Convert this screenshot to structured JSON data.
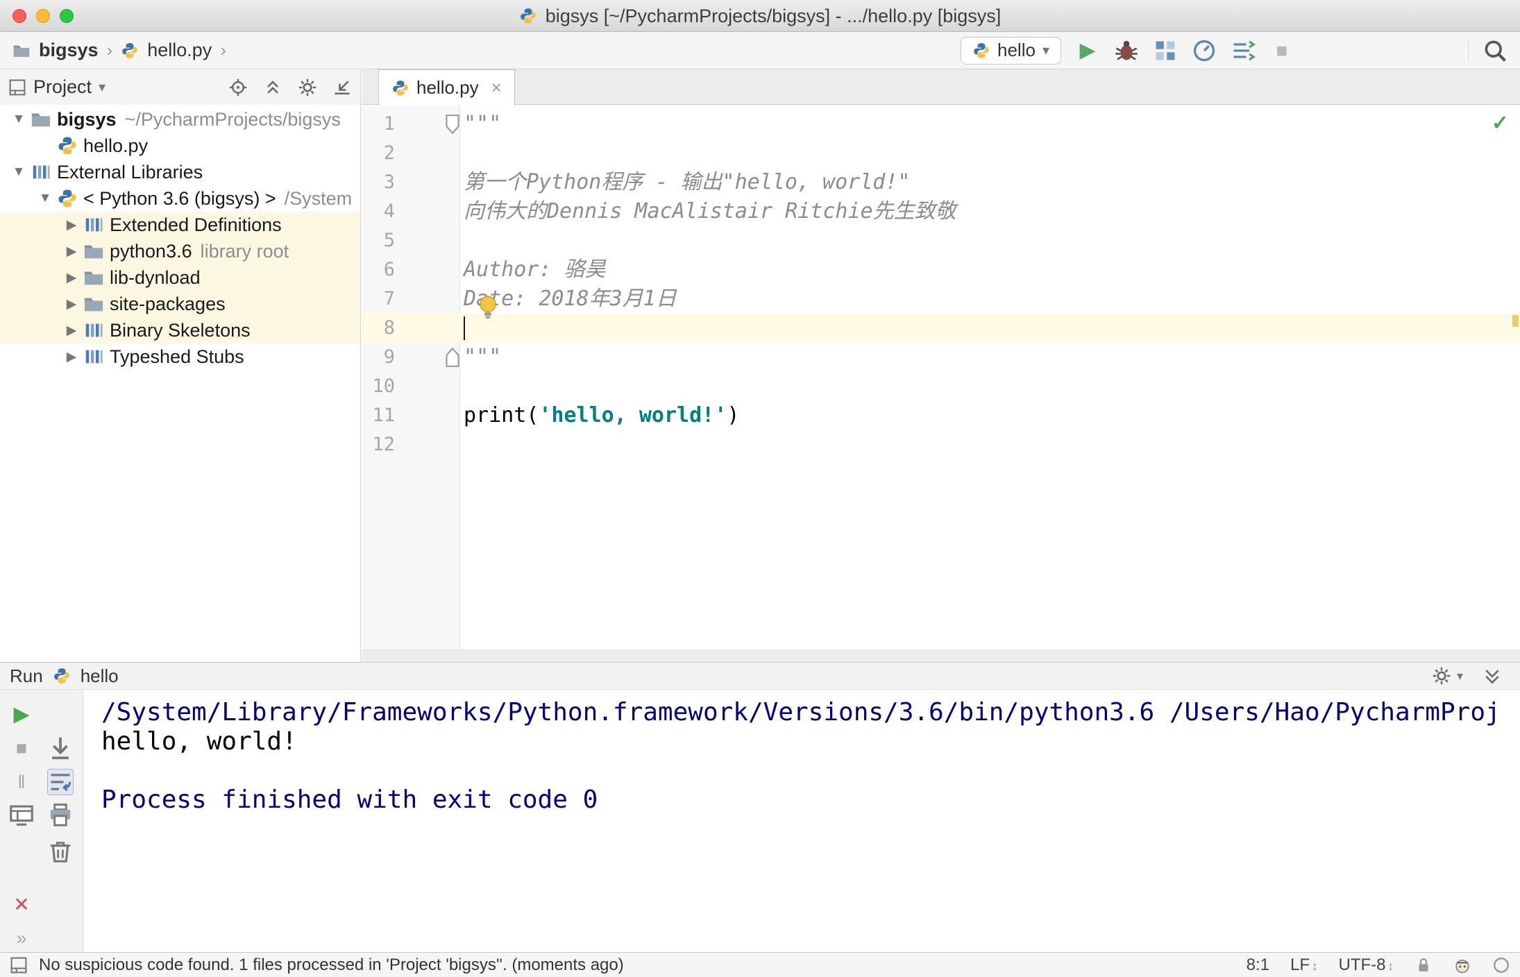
{
  "colors": {
    "string": "#008080",
    "docstring": "#8c8c8c",
    "console_system": "#000080",
    "current_line_highlight": "#fffae3",
    "library_row_highlight": "#fbf7e1",
    "run_green": "#59a869"
  },
  "titlebar": {
    "title": "bigsys [~/PycharmProjects/bigsys] - .../hello.py [bigsys]"
  },
  "navbar": {
    "breadcrumb": {
      "project": "bigsys",
      "file": "hello.py"
    },
    "run_config": "hello"
  },
  "project": {
    "header": {
      "title": "Project"
    },
    "tree": [
      {
        "level": 0,
        "chevron": "expanded",
        "icon": "folder",
        "label": "bigsys",
        "detail": "~/PycharmProjects/bigsys",
        "bold": true,
        "highlight": false
      },
      {
        "level": 1,
        "chevron": "none",
        "icon": "python",
        "label": "hello.py",
        "detail": "",
        "bold": false,
        "highlight": false
      },
      {
        "level": 0,
        "chevron": "expanded",
        "icon": "library",
        "label": "External Libraries",
        "detail": "",
        "bold": false,
        "highlight": false
      },
      {
        "level": 1,
        "chevron": "expanded",
        "icon": "python",
        "label": "< Python 3.6 (bigsys) >",
        "detail": "/System",
        "bold": false,
        "highlight": false
      },
      {
        "level": 2,
        "chevron": "collapsed",
        "icon": "library",
        "label": "Extended Definitions",
        "detail": "",
        "bold": false,
        "highlight": true
      },
      {
        "level": 2,
        "chevron": "collapsed",
        "icon": "folder",
        "label": "python3.6",
        "detail": "library root",
        "bold": false,
        "highlight": true
      },
      {
        "level": 2,
        "chevron": "collapsed",
        "icon": "folder",
        "label": "lib-dynload",
        "detail": "",
        "bold": false,
        "highlight": true
      },
      {
        "level": 2,
        "chevron": "collapsed",
        "icon": "folder",
        "label": "site-packages",
        "detail": "",
        "bold": false,
        "highlight": true
      },
      {
        "level": 2,
        "chevron": "collapsed",
        "icon": "library",
        "label": "Binary Skeletons",
        "detail": "",
        "bold": false,
        "highlight": true
      },
      {
        "level": 2,
        "chevron": "collapsed",
        "icon": "library",
        "label": "Typeshed Stubs",
        "detail": "",
        "bold": false,
        "highlight": false
      }
    ]
  },
  "editor": {
    "tab": {
      "label": "hello.py",
      "close_glyph": "×"
    },
    "lines": [
      {
        "num": "1",
        "fold": "start",
        "segs": [
          {
            "c": "doc",
            "t": "\"\"\""
          }
        ]
      },
      {
        "num": "2",
        "segs": []
      },
      {
        "num": "3",
        "segs": [
          {
            "c": "doc",
            "t": "第一个Python程序 - 输出\"hello, world!\""
          }
        ]
      },
      {
        "num": "4",
        "segs": [
          {
            "c": "doc",
            "t": "向伟大的Dennis MacAlistair Ritchie先生致敬"
          }
        ]
      },
      {
        "num": "5",
        "segs": []
      },
      {
        "num": "6",
        "segs": [
          {
            "c": "doc",
            "t": "Author: 骆昊"
          }
        ]
      },
      {
        "num": "7",
        "segs": [
          {
            "c": "doc",
            "t": "Date: 2018年3月1日"
          }
        ]
      },
      {
        "num": "8",
        "current": true,
        "caret": true,
        "segs": []
      },
      {
        "num": "9",
        "fold": "end",
        "segs": [
          {
            "c": "doc",
            "t": "\"\"\""
          }
        ]
      },
      {
        "num": "10",
        "segs": []
      },
      {
        "num": "11",
        "segs": [
          {
            "c": "plain",
            "t": "print("
          },
          {
            "c": "str",
            "t": "'hello, world!'"
          },
          {
            "c": "plain",
            "t": ")"
          }
        ]
      },
      {
        "num": "12",
        "segs": []
      }
    ]
  },
  "run": {
    "title": "Run",
    "config": "hello",
    "console": [
      {
        "style": "system",
        "text": "/System/Library/Frameworks/Python.framework/Versions/3.6/bin/python3.6 /Users/Hao/PycharmProj"
      },
      {
        "style": "stdout",
        "text": "hello, world!"
      },
      {
        "style": "stdout",
        "text": ""
      },
      {
        "style": "system",
        "text": "Process finished with exit code 0"
      }
    ]
  },
  "statusbar": {
    "message": "No suspicious code found. 1 files processed in 'Project 'bigsys''. (moments ago)",
    "caret_position": "8:1",
    "line_separator": "LF",
    "encoding": "UTF-8"
  },
  "glyphs": {
    "tree_expanded": "▼",
    "tree_collapsed": "▶",
    "dropdown": "▾",
    "separator": "›",
    "play": "▶",
    "stop": "■",
    "pause": "‖",
    "close": "✕",
    "more": "»",
    "check": "✓",
    "updown": "↕"
  }
}
